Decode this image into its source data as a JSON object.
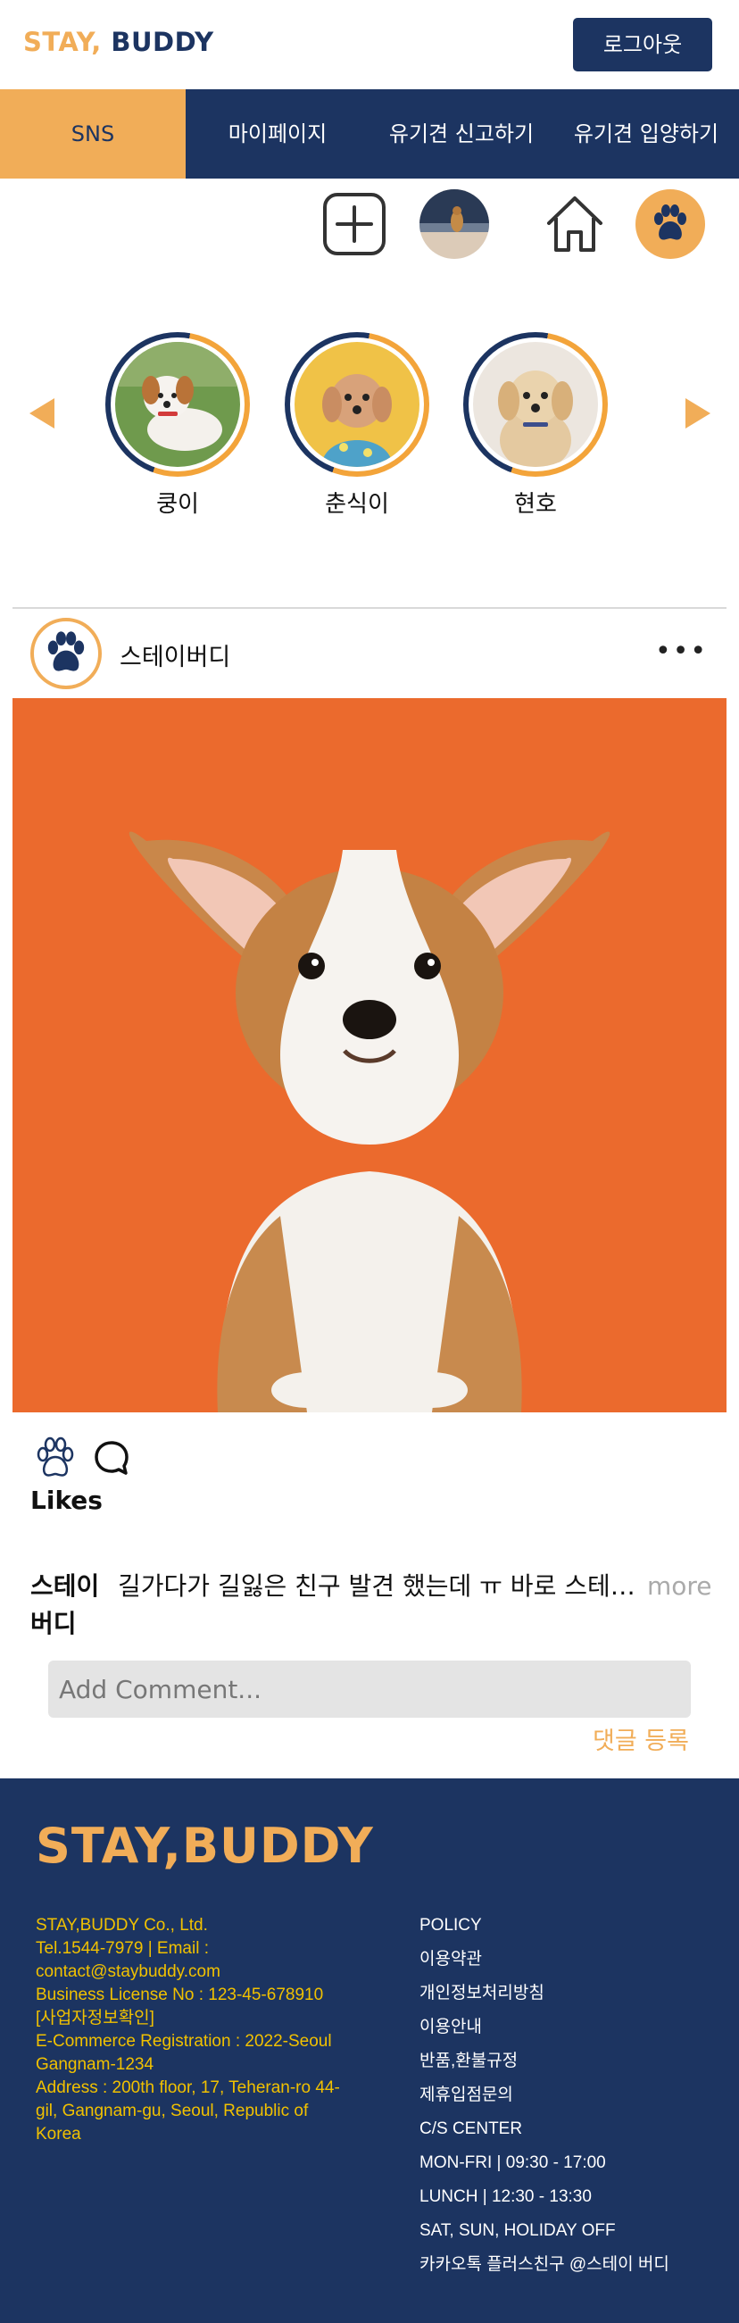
{
  "header": {
    "logo_part1": "STAY,",
    "logo_part2": " BUDDY",
    "logout_label": "로그아웃"
  },
  "nav": {
    "items": [
      {
        "label": "SNS",
        "active": true
      },
      {
        "label": "마이페이지",
        "active": false
      },
      {
        "label": "유기견 신고하기",
        "active": false
      },
      {
        "label": "유기견 입양하기",
        "active": false
      }
    ]
  },
  "toolbar": {
    "icons": [
      "plus-square-icon",
      "profile-avatar",
      "home-icon",
      "paw-icon"
    ]
  },
  "stories": {
    "items": [
      {
        "name": "쿵이"
      },
      {
        "name": "춘식이"
      },
      {
        "name": "현호"
      }
    ]
  },
  "post": {
    "username": "스테이버디",
    "likes_label": "Likes",
    "caption_user": "스테이버디",
    "caption_text": "길가다가 길잃은 친구 발견 했는데 ㅠ 바로 스테이버디에 신고했어요",
    "more_label": "more",
    "comment_placeholder": "Add Comment...",
    "comment_submit": "댓글 등록"
  },
  "footer": {
    "logo": "STAY,BUDDY",
    "info": [
      "STAY,BUDDY Co., Ltd.",
      "Tel.1544-7979 | Email : contact@staybuddy.com",
      "Business License No : 123-45-678910 [사업자정보확인]",
      "E-Commerce Registration : 2022-Seoul Gangnam-1234",
      "Address : 200th floor, 17, Teheran-ro 44-gil, Gangnam-gu, Seoul, Republic of Korea"
    ],
    "policy": [
      "POLICY",
      "이용약관",
      "개인정보처리방침",
      "이용안내",
      "반품,환불규정",
      "제휴입점문의",
      "C/S CENTER",
      "MON-FRI | 09:30 - 17:00",
      "LUNCH  |  12:30 - 13:30",
      "SAT, SUN, HOLIDAY OFF",
      "카카오톡 플러스친구 @스테이 버디"
    ]
  },
  "colors": {
    "navy": "#1c3461",
    "orange": "#f1ad58",
    "photo_bg": "#eb6a2d",
    "footer_text": "#f1c100"
  }
}
